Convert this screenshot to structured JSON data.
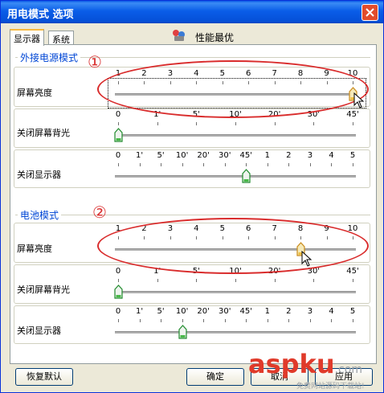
{
  "window": {
    "title": "用电模式 选项"
  },
  "tabs": [
    {
      "label": "显示器"
    },
    {
      "label": "系统"
    }
  ],
  "mode": {
    "label": "性能最优"
  },
  "annotations": {
    "one": "①",
    "two": "②"
  },
  "ac": {
    "section_title": "外接电源模式",
    "brightness": {
      "label": "屏幕亮度",
      "ticks": [
        "1",
        "2",
        "3",
        "4",
        "5",
        "6",
        "7",
        "8",
        "9",
        "10"
      ],
      "value": "10"
    },
    "backlight": {
      "label": "关闭屏幕背光",
      "ticks": [
        "0",
        "1'",
        "5'",
        "10'",
        "20'",
        "30'",
        "45'"
      ],
      "value": "0"
    },
    "display": {
      "label": "关闭显示器",
      "ticks": [
        "0",
        "1'",
        "5'",
        "10'",
        "20'",
        "30'",
        "45'",
        "1",
        "2",
        "3",
        "4",
        "5"
      ],
      "value": "45'"
    }
  },
  "battery": {
    "section_title": "电池模式",
    "brightness": {
      "label": "屏幕亮度",
      "ticks": [
        "1",
        "2",
        "3",
        "4",
        "5",
        "6",
        "7",
        "8",
        "9",
        "10"
      ],
      "value": "8"
    },
    "backlight": {
      "label": "关闭屏幕背光",
      "ticks": [
        "0",
        "1'",
        "5'",
        "10'",
        "20'",
        "30'",
        "45'"
      ],
      "value": "0"
    },
    "display": {
      "label": "关闭显示器",
      "ticks": [
        "0",
        "1'",
        "5'",
        "10'",
        "20'",
        "30'",
        "45'",
        "1",
        "2",
        "3",
        "4",
        "5"
      ],
      "value": "10'"
    }
  },
  "buttons": {
    "reset": "恢复默认",
    "ok": "确定",
    "cancel": "取消",
    "apply": "应用"
  },
  "watermark": {
    "main": "aspku",
    "suffix": ".com",
    "sub": "免费网站源码下载站!"
  },
  "colors": {
    "title_bar": "#0a5de8",
    "section_title": "#0046d5",
    "annotation": "#d92c2c",
    "watermark": "#e03a2a"
  }
}
